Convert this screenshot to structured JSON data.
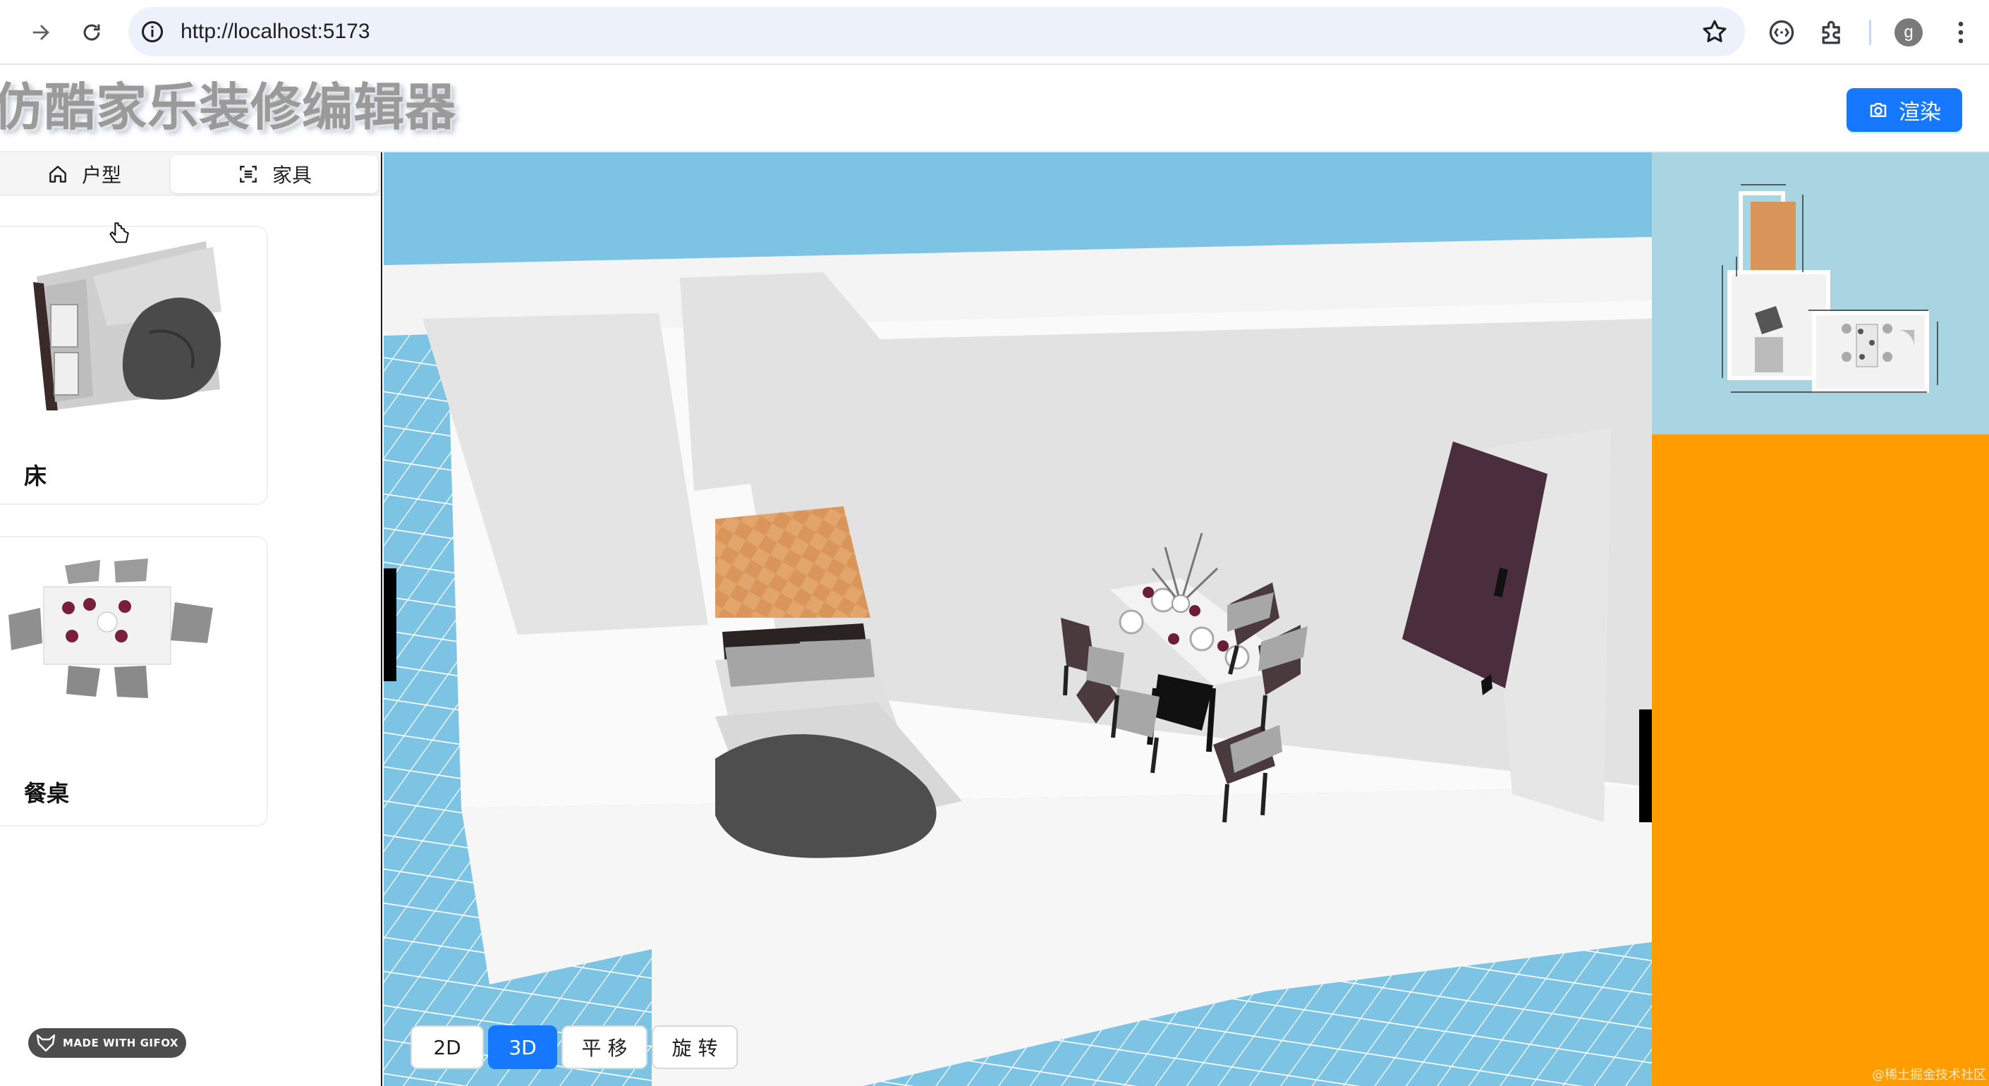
{
  "browser": {
    "url": "http://localhost:5173",
    "avatar_letter": "g"
  },
  "header": {
    "title": "仿酷家乐装修编辑器",
    "render_button": "渲染"
  },
  "sidebar": {
    "tabs": [
      {
        "label": "户型",
        "icon": "home-icon",
        "active": false
      },
      {
        "label": "家具",
        "icon": "scan-icon",
        "active": true
      }
    ],
    "items": [
      {
        "label": "床",
        "thumb": "bed-thumbnail"
      },
      {
        "label": "餐桌",
        "thumb": "dining-table-thumbnail"
      }
    ],
    "badge": "MADE WITH GIFOX"
  },
  "viewport": {
    "modes": [
      {
        "label": "2D",
        "active": false
      },
      {
        "label": "3D",
        "active": true
      },
      {
        "label": "平 移",
        "active": false
      },
      {
        "label": "旋 转",
        "active": false
      }
    ]
  },
  "right_panel": {
    "watermark": "@稀土掘金技术社区"
  },
  "colors": {
    "accent": "#1677ff",
    "panel": "#ff9d00",
    "sky": "#7dc4e4",
    "door": "#4b2e3e",
    "floor_wood": "#d9955a"
  }
}
